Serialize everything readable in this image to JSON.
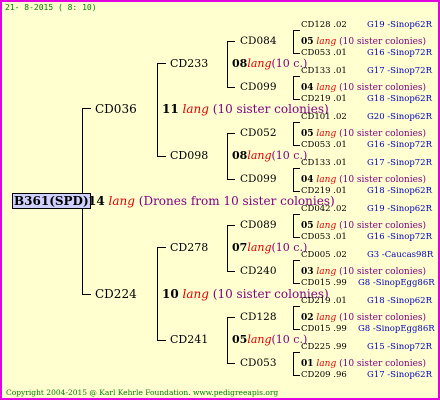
{
  "date": "21- 8-2015 ( 8: 10)",
  "footer": "Copyright 2004-2015 @ Karl Kehrle Foundation.   www.pedigreeapis.org",
  "root": {
    "id": "B361(SPD)"
  },
  "mate_root": {
    "num": "14",
    "lang": "lang",
    "desc": "(Drones from 10 sister colonies)"
  },
  "g1": [
    {
      "id": "CD036",
      "mate": {
        "num": "11",
        "lang": "lang",
        "desc": "(10 sister colonies)"
      }
    },
    {
      "id": "CD224",
      "mate": {
        "num": "10",
        "lang": "lang",
        "desc": "(10 sister colonies)"
      }
    }
  ],
  "g2": [
    {
      "id": "CD233",
      "mate": {
        "num": "08",
        "lang": "lang",
        "desc": "(10 c.)"
      }
    },
    {
      "id": "CD098",
      "mate": {
        "num": "08",
        "lang": "lang",
        "desc": "(10 c.)"
      }
    },
    {
      "id": "CD278",
      "mate": {
        "num": "07",
        "lang": "lang",
        "desc": "(10 c.)"
      }
    },
    {
      "id": "CD241",
      "mate": {
        "num": "05",
        "lang": "lang",
        "desc": "(10 c.)"
      }
    }
  ],
  "g3": [
    {
      "id": "CD084",
      "mate": {
        "num": "05",
        "lang": "lang",
        "desc": "(10 sister colonies)"
      }
    },
    {
      "id": "CD099",
      "mate": {
        "num": "04",
        "lang": "lang",
        "desc": "(10 sister colonies)"
      }
    },
    {
      "id": "CD052",
      "mate": {
        "num": "05",
        "lang": "lang",
        "desc": "(10 sister colonies)"
      }
    },
    {
      "id": "CD099",
      "mate": {
        "num": "04",
        "lang": "lang",
        "desc": "(10 sister colonies)"
      }
    },
    {
      "id": "CD089",
      "mate": {
        "num": "05",
        "lang": "lang",
        "desc": "(10 sister colonies)"
      }
    },
    {
      "id": "CD240",
      "mate": {
        "num": "03",
        "lang": "lang",
        "desc": "(10 sister colonies)"
      }
    },
    {
      "id": "CD128",
      "mate": {
        "num": "02",
        "lang": "lang",
        "desc": "(10 sister colonies)"
      }
    },
    {
      "id": "CD053",
      "mate": {
        "num": "01",
        "lang": "lang",
        "desc": "(10 sister colonies)"
      }
    }
  ],
  "g4": [
    {
      "id": "CD128 .02",
      "src": "G19 -Sinop62R"
    },
    {
      "id": "CD053 .01",
      "src": "G16 -Sinop72R"
    },
    {
      "id": "CD133 .01",
      "src": "G17 -Sinop72R"
    },
    {
      "id": "CD219 .01",
      "src": "G18 -Sinop62R"
    },
    {
      "id": "CD101 .02",
      "src": "G20 -Sinop62R"
    },
    {
      "id": "CD053 .01",
      "src": "G16 -Sinop72R"
    },
    {
      "id": "CD133 .01",
      "src": "G17 -Sinop72R"
    },
    {
      "id": "CD219 .01",
      "src": "G18 -Sinop62R"
    },
    {
      "id": "CD042 .02",
      "src": "G19 -Sinop62R"
    },
    {
      "id": "CD053 .01",
      "src": "G16 -Sinop72R"
    },
    {
      "id": "CD005 .02",
      "src": "G3 -Caucas98R"
    },
    {
      "id": "CD015 .99",
      "src": "G8 -SinopEgg86R"
    },
    {
      "id": "CD219 .01",
      "src": "G18 -Sinop62R"
    },
    {
      "id": "CD015 .99",
      "src": "G8 -SinopEgg86R"
    },
    {
      "id": "CD225 .99",
      "src": "G15 -Sinop72R"
    },
    {
      "id": "CD209 .96",
      "src": "G17 -Sinop62R"
    }
  ]
}
